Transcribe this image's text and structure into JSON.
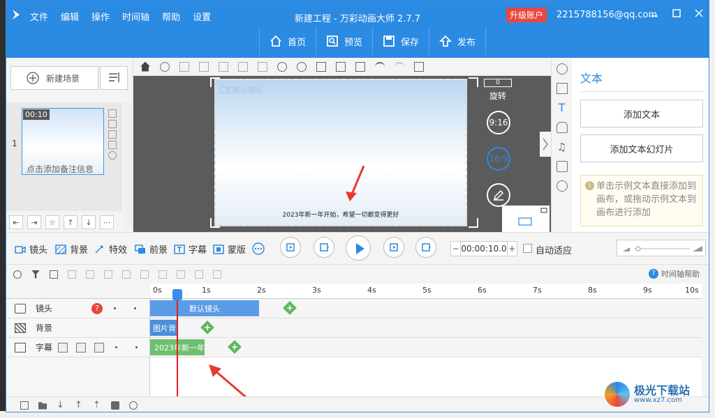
{
  "app": {
    "title": "新建工程 - 万彩动画大师 2.7.7",
    "menu": [
      "文件",
      "编辑",
      "操作",
      "时间轴",
      "帮助",
      "设置"
    ],
    "upgrade_label": "升级账户",
    "user_email": "2215788156@qq.com",
    "accent": "#2b8ae2"
  },
  "toolbar": {
    "home": "首页",
    "preview": "预览",
    "save": "保存",
    "publish": "发布"
  },
  "scenes": {
    "new_scene_label": "新建场景",
    "items": [
      {
        "index": "1",
        "duration": "00:10",
        "note": "点击添加备注信息"
      }
    ]
  },
  "canvas": {
    "camera_label": "默认镜头",
    "caption_text": "2023年新一年开始，希望一切都变得更好",
    "rotate_value": "0",
    "rotate_label": "旋转",
    "ratio_916": "9:16",
    "ratio_169": "16:9"
  },
  "text_panel": {
    "title": "文本",
    "add_text": "添加文本",
    "add_text_slide": "添加文本幻灯片",
    "hint": "单击示例文本直接添加到画布，或拖动示例文本到画布进行添加"
  },
  "playbar": {
    "camera": "镜头",
    "background": "背景",
    "effects": "特效",
    "foreground": "前景",
    "subtitle": "字幕",
    "mask": "蒙版",
    "time_value": "00:00:10.0",
    "auto_fit": "自动适应"
  },
  "timeline": {
    "help_label": "时间轴帮助",
    "ticks": [
      "0s",
      "1s",
      "2s",
      "3s",
      "4s",
      "5s",
      "6s",
      "7s",
      "8s",
      "9s",
      "10s"
    ],
    "tracks": [
      {
        "name": "镜头",
        "clip": "默认镜头",
        "clip_color": "#5b9be6"
      },
      {
        "name": "背景",
        "clip": "图片背",
        "clip_color": "#4a8fd8"
      },
      {
        "name": "字幕",
        "clip": "2023年新一年",
        "clip_color": "#6cc070"
      }
    ]
  },
  "watermark": {
    "name": "极光下载站",
    "url": "www.xz7.com"
  }
}
